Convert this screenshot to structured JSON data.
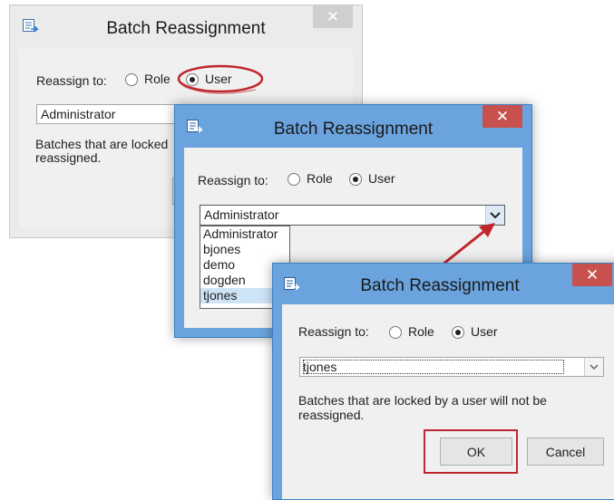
{
  "windows": {
    "back": {
      "title": "Batch Reassignment",
      "close_glyph": "✕",
      "reassign_label": "Reassign to:",
      "role_label": "Role",
      "user_label": "User",
      "selected": "user",
      "combo_value": "Administrator",
      "note": "Batches that are locked\nreassigned."
    },
    "middle": {
      "title": "Batch Reassignment",
      "close_glyph": "✕",
      "reassign_label": "Reassign to:",
      "role_label": "Role",
      "user_label": "User",
      "selected": "user",
      "combo_value": "Administrator",
      "dropdown_glyph": "⌄",
      "dropdown_options": [
        "Administrator",
        "bjones",
        "demo",
        "dogden",
        "tjones"
      ],
      "highlighted_option": "tjones"
    },
    "front": {
      "title": "Batch Reassignment",
      "close_glyph": "✕",
      "reassign_label": "Reassign to:",
      "role_label": "Role",
      "user_label": "User",
      "selected": "user",
      "combo_value": "tjones",
      "dropdown_glyph": "⌄",
      "note": "Batches that are locked by a user will not be\nreassigned.",
      "ok_label": "OK",
      "cancel_label": "Cancel"
    }
  },
  "annotations": {
    "highlight_color": "#c0272d",
    "arrow_color": "#c0272d"
  },
  "icons": {
    "app": "batch-reassign-icon",
    "close": "close-icon",
    "dropdown": "chevron-down-icon"
  }
}
